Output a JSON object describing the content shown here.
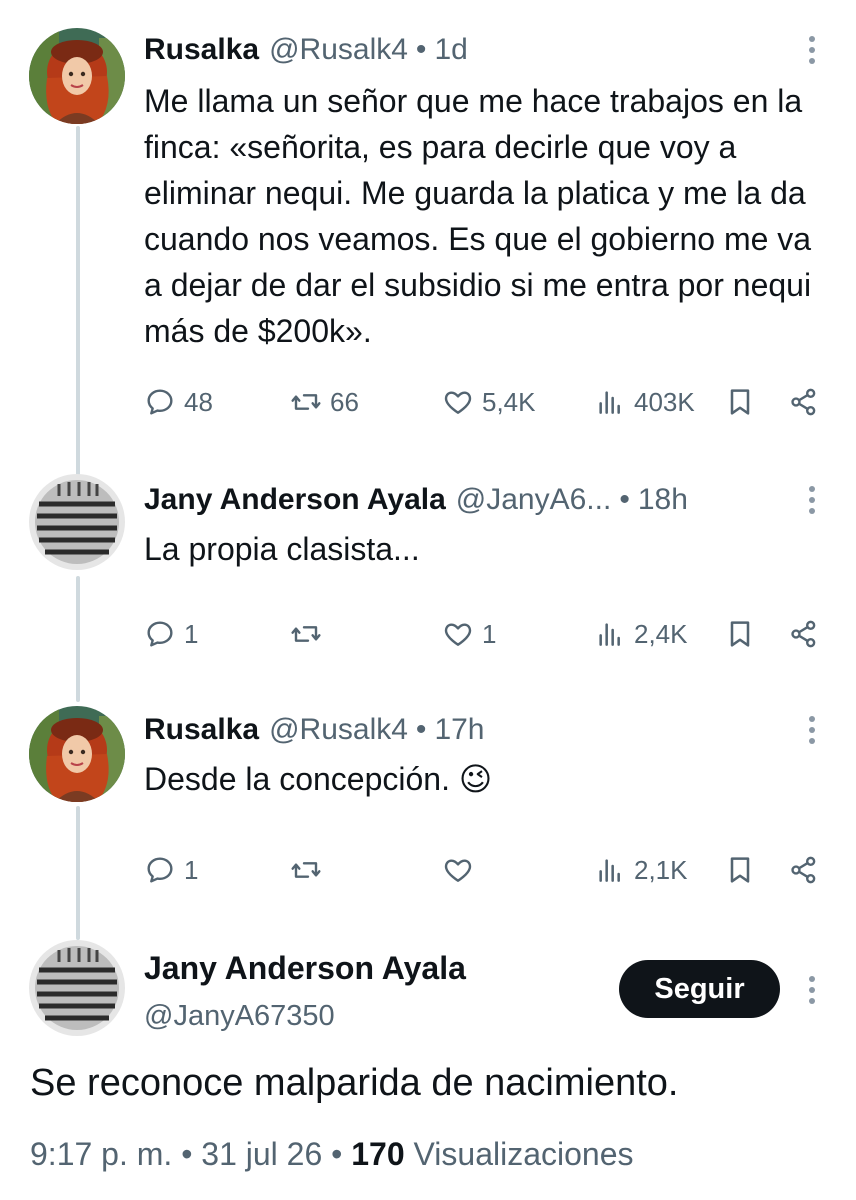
{
  "thread": [
    {
      "name": "Rusalka",
      "handle": "@Rusalk4",
      "time": "1d",
      "text": "Me llama un señor que me hace trabajos en la finca: «señorita, es para decirle que voy a eliminar nequi. Me guarda la platica y me la da cuando nos veamos. Es que el gobierno me va a dejar de dar el subsidio si me entra por nequi más de $200k».",
      "replies": "48",
      "retweets": "66",
      "likes": "5,4K",
      "views": "403K",
      "avatar": "redhead-woman-avatar"
    },
    {
      "name": "Jany Anderson Ayala",
      "handle": "@JanyA6...",
      "time": "18h",
      "text": "La propia clasista...",
      "replies": "1",
      "retweets": "",
      "likes": "1",
      "views": "2,4K",
      "avatar": "microphone-avatar"
    },
    {
      "name": "Rusalka",
      "handle": "@Rusalk4",
      "time": "17h",
      "text": "Desde la concepción. 😉",
      "replies": "1",
      "retweets": "",
      "likes": "",
      "views": "2,1K",
      "avatar": "redhead-woman-avatar"
    }
  ],
  "main_tweet": {
    "name": "Jany Anderson Ayala",
    "handle": "@JanyA67350",
    "follow_label": "Seguir",
    "text": "Se reconoce malparida de nacimiento.",
    "time": "9:17 p. m.",
    "date": "31 jul 26",
    "views_count": "170",
    "views_label": "Visualizaciones",
    "separator": "•",
    "avatar": "microphone-avatar"
  },
  "colors": {
    "text": "#0f1419",
    "secondary": "#536471",
    "thread_line": "#cfd9de",
    "button": "#0f1419"
  }
}
